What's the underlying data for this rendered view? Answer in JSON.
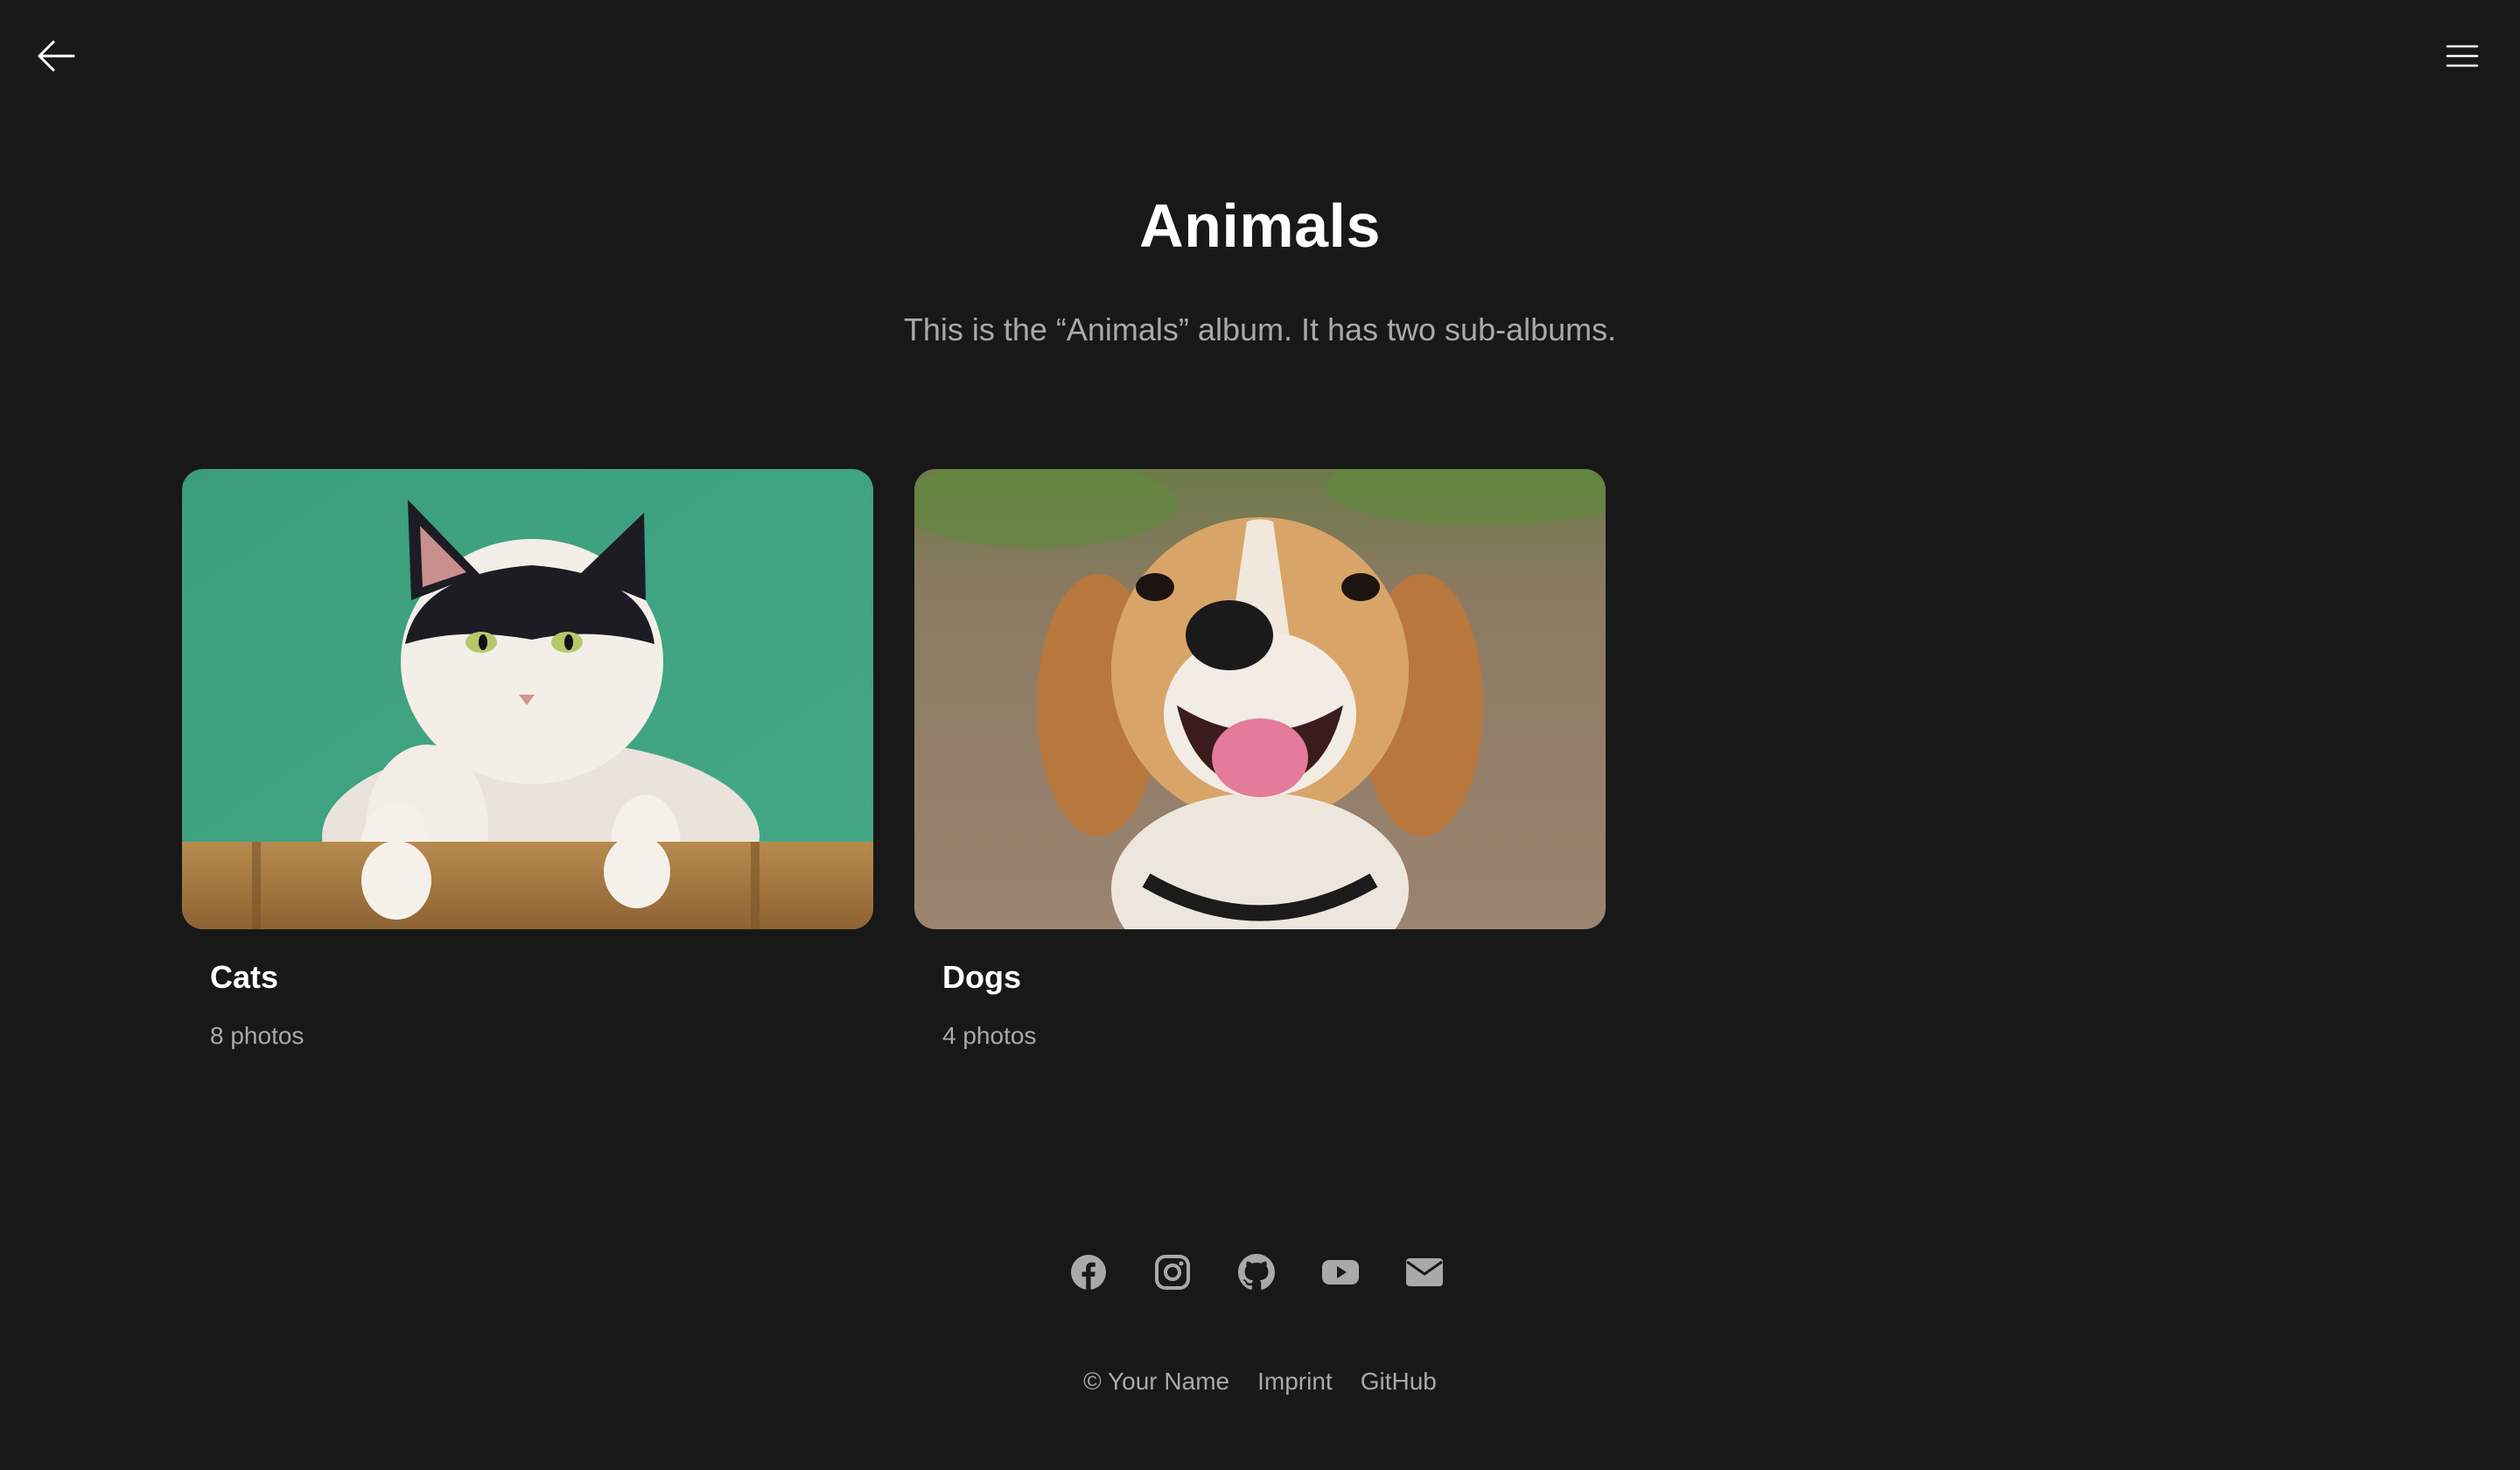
{
  "nav": {
    "back_icon": "arrow-left-icon",
    "menu_icon": "hamburger-menu-icon"
  },
  "album": {
    "title": "Animals",
    "description": "This is the “Animals” album. It has two sub-albums."
  },
  "sub_albums": [
    {
      "title": "Cats",
      "count": "8 photos",
      "image": "cat photo"
    },
    {
      "title": "Dogs",
      "count": "4 photos",
      "image": "beagle dog photo"
    }
  ],
  "social_icons": [
    "facebook-icon",
    "instagram-icon",
    "github-icon",
    "youtube-icon",
    "mail-icon"
  ],
  "footer": {
    "copyright": "© Your Name",
    "imprint": "Imprint",
    "github": "GitHub"
  },
  "colors": {
    "background": "#181818",
    "text_primary": "#ffffff",
    "text_secondary": "#a9a9a9"
  }
}
